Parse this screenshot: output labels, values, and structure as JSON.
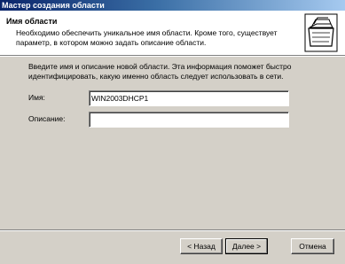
{
  "window": {
    "title": "Мастер создания области"
  },
  "header": {
    "title": "Имя области",
    "description": "Необходимо обеспечить уникальное имя области. Кроме того, существует параметр, в котором можно задать описание области.",
    "icon": "scope-folder-icon"
  },
  "body": {
    "intro": "Введите имя и описание новой области. Эта информация поможет быстро идентифицировать, какую именно область следует использовать в сети.",
    "name_label": "Имя:",
    "name_value": "WIN2003DHCP1",
    "description_label": "Описание:",
    "description_value": ""
  },
  "buttons": {
    "back": "< Назад",
    "next": "Далее >",
    "cancel": "Отмена"
  }
}
